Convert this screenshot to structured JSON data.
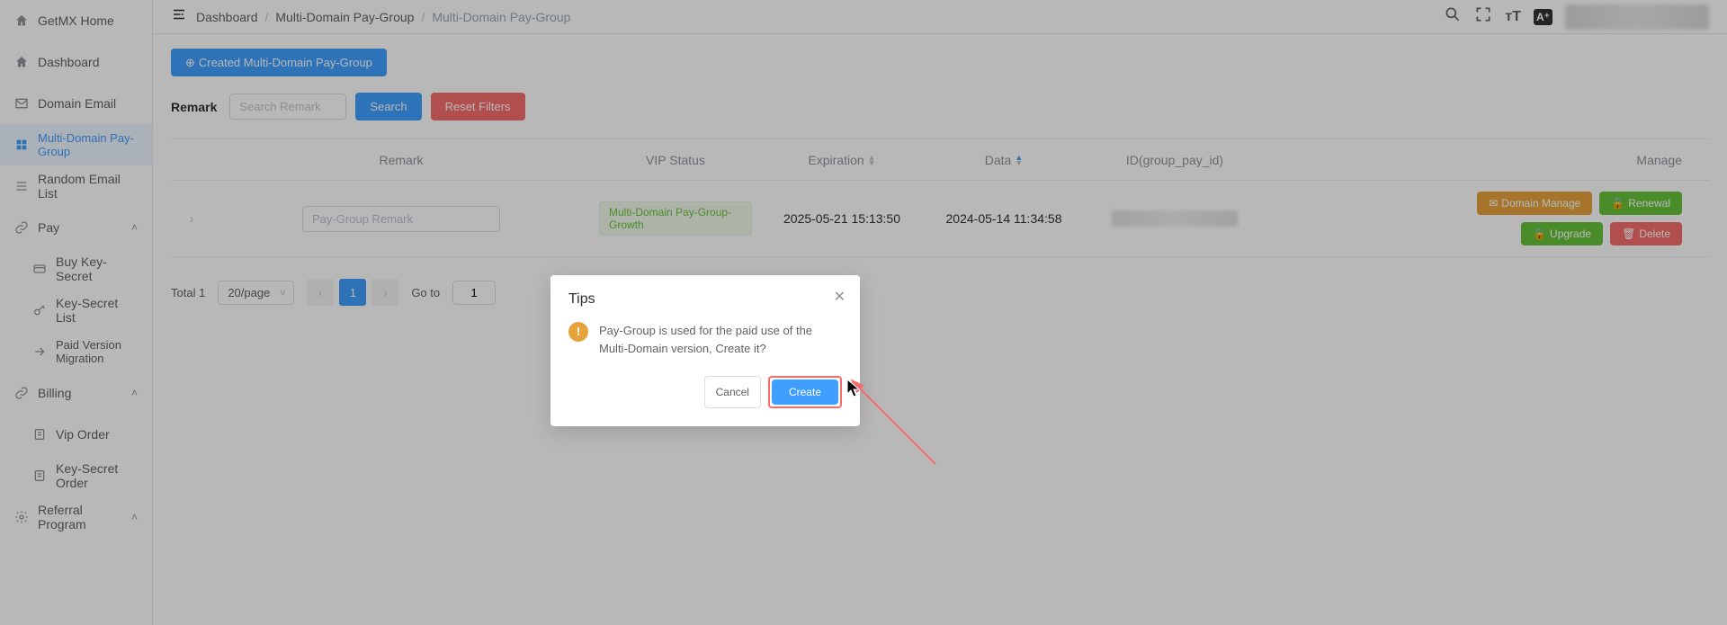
{
  "sidebar": {
    "items": [
      {
        "label": "GetMX Home"
      },
      {
        "label": "Dashboard"
      },
      {
        "label": "Domain Email"
      },
      {
        "label": "Multi-Domain Pay-Group"
      },
      {
        "label": "Random Email List"
      },
      {
        "label": "Pay"
      },
      {
        "label": "Buy Key-Secret"
      },
      {
        "label": "Key-Secret List"
      },
      {
        "label": "Paid Version Migration"
      },
      {
        "label": "Billing"
      },
      {
        "label": "Vip Order"
      },
      {
        "label": "Key-Secret Order"
      },
      {
        "label": "Referral Program"
      }
    ]
  },
  "breadcrumb": {
    "items": [
      "Dashboard",
      "Multi-Domain Pay-Group",
      "Multi-Domain Pay-Group"
    ]
  },
  "toolbar": {
    "create_btn": "Created Multi-Domain Pay-Group"
  },
  "filter": {
    "label": "Remark",
    "placeholder": "Search Remark",
    "search_btn": "Search",
    "reset_btn": "Reset Filters"
  },
  "table": {
    "headers": {
      "remark": "Remark",
      "vip": "VIP Status",
      "expiration": "Expiration",
      "data": "Data",
      "id": "ID(group_pay_id)",
      "manage": "Manage"
    },
    "rows": [
      {
        "remark_placeholder": "Pay-Group Remark",
        "vip_tag": "Multi-Domain Pay-Group-Growth",
        "expiration": "2025-05-21 15:13:50",
        "data": "2024-05-14 11:34:58",
        "manage": {
          "domain": "Domain Manage",
          "renewal": "Renewal",
          "upgrade": "Upgrade",
          "delete": "Delete"
        }
      }
    ]
  },
  "pagination": {
    "total_label": "Total 1",
    "page_size": "20/page",
    "current": "1",
    "goto_label": "Go to",
    "goto_value": "1"
  },
  "dialog": {
    "title": "Tips",
    "message": "Pay-Group is used for the paid use of the Multi-Domain version, Create it?",
    "cancel": "Cancel",
    "create": "Create"
  }
}
